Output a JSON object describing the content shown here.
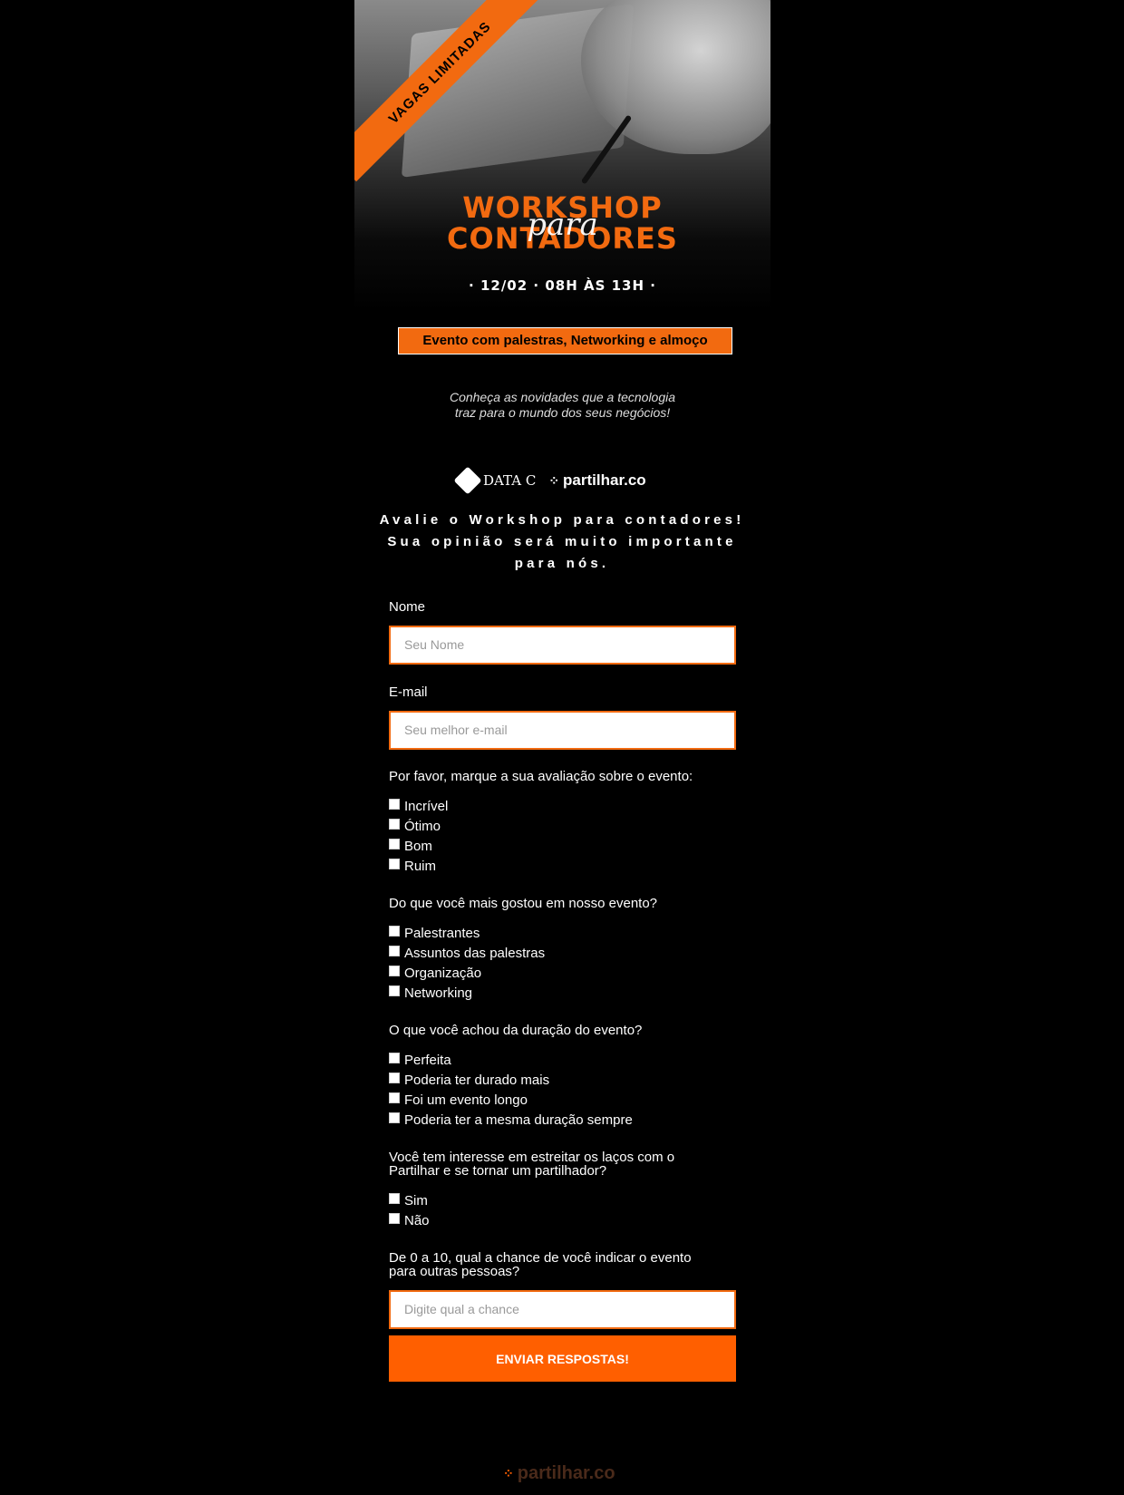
{
  "hero": {
    "ribbon": "VAGAS LIMITADAS",
    "title_line1": "WORKSHOP",
    "title_script": "para",
    "title_line2": "CONTADORES",
    "date": "· 12/02 · 08H ÀS 13H ·",
    "badge": "Evento com palestras, Networking e almoço",
    "tagline_line1": "Conheça as novidades que a tecnologia",
    "tagline_line2": "traz para o mundo dos seus negócios!"
  },
  "logos": {
    "datac": "DATA C",
    "partilhar": "partilhar.co"
  },
  "heading": {
    "line1": "Avalie o Workshop para contadores!",
    "line2": "Sua opinião será muito importante",
    "line3": "para nós."
  },
  "form": {
    "name_label": "Nome",
    "name_placeholder": "Seu Nome",
    "email_label": "E-mail",
    "email_placeholder": "Seu melhor e-mail",
    "q1": "Por favor, marque a sua avaliação sobre o evento:",
    "q1_options": [
      "Incrível",
      "Ótimo",
      "Bom",
      "Ruim"
    ],
    "q2": "Do que você mais gostou em nosso evento?",
    "q2_options": [
      "Palestrantes",
      "Assuntos das palestras",
      "Organização",
      "Networking"
    ],
    "q3": "O que você achou da duração do evento?",
    "q3_options": [
      "Perfeita",
      "Poderia ter durado mais",
      "Foi um evento longo",
      "Poderia ter a mesma duração sempre"
    ],
    "q4_line1": "Você tem interesse em estreitar os laços com o",
    "q4_line2": "Partilhar e se tornar um partilhador?",
    "q4_options": [
      "Sim",
      "Não"
    ],
    "q5_line1": "De 0 a 10, qual a chance de você indicar o evento",
    "q5_line2": "para outras pessoas?",
    "score_placeholder": "Digite qual a chance",
    "submit": "ENVIAR RESPOSTAS!"
  },
  "footer": {
    "logo": "partilhar.co"
  },
  "colors": {
    "accent": "#f26a10",
    "button": "#ff5f00",
    "background": "#000000"
  }
}
